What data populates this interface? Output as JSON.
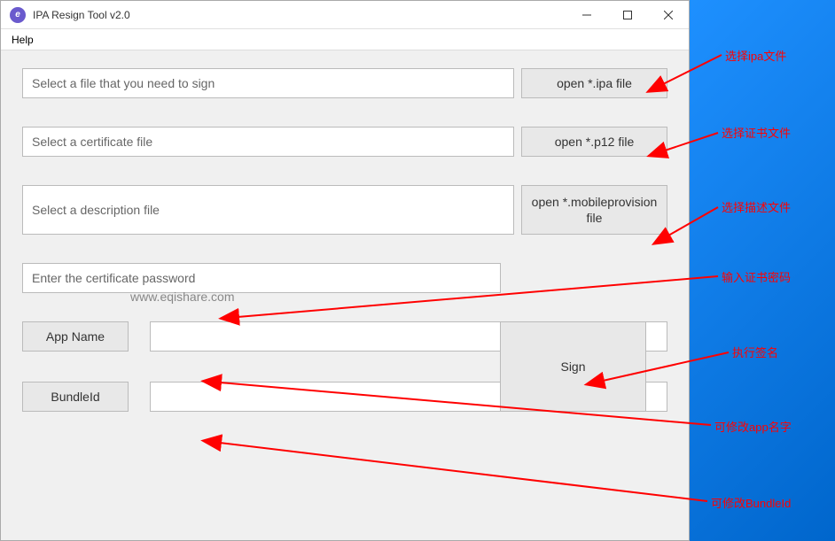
{
  "window": {
    "title": "IPA Resign Tool v2.0"
  },
  "menubar": {
    "help": "Help"
  },
  "rows": {
    "ipa": {
      "placeholder": "Select a file that you need to sign",
      "button": "open *.ipa file"
    },
    "cert": {
      "placeholder": "Select a certificate file",
      "button": "open *.p12 file"
    },
    "provision": {
      "placeholder": "Select a description file",
      "button": "open *.mobileprovision file"
    },
    "password": {
      "placeholder": "Enter the certificate password"
    },
    "appname": {
      "label": "App Name"
    },
    "bundleid": {
      "label": "BundleId"
    },
    "sign": {
      "button": "Sign"
    }
  },
  "watermark": "www.eqishare.com",
  "annotations": {
    "ipa": "选择ipa文件",
    "cert": "选择证书文件",
    "provision": "选择描述文件",
    "password": "输入证书密码",
    "sign": "执行签名",
    "appname": "可修改app名字",
    "bundleid": "可修改BundleId"
  }
}
